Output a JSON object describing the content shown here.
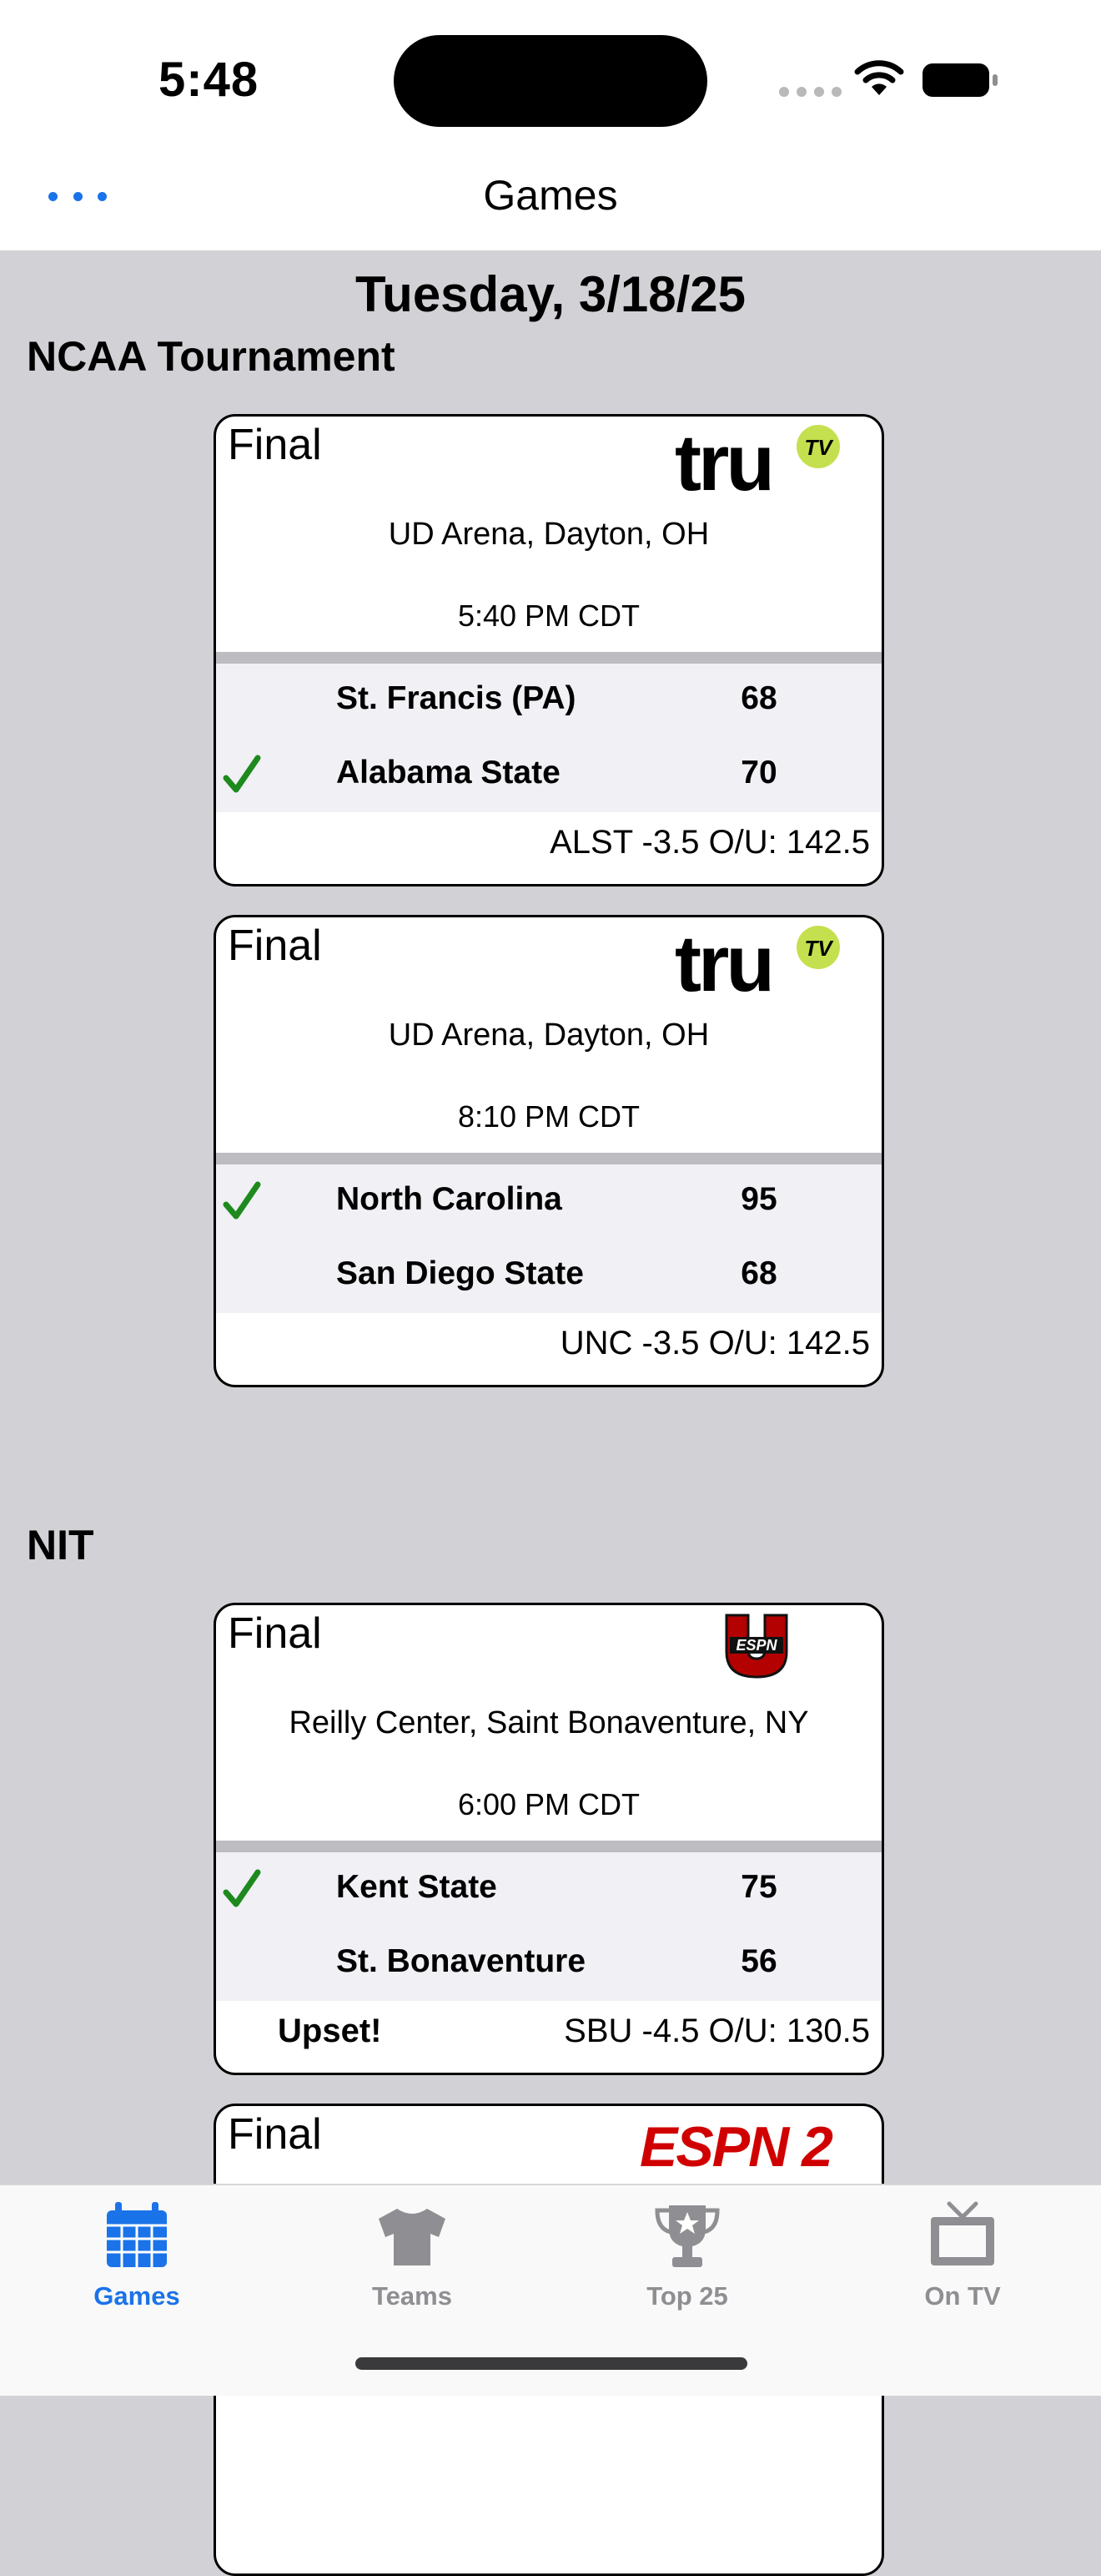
{
  "status_bar": {
    "time": "5:48"
  },
  "nav": {
    "title": "Games",
    "more_icon": "ellipsis-icon"
  },
  "date": "Tuesday, 3/18/25",
  "sections": [
    {
      "name": "NCAA Tournament",
      "games": [
        {
          "status": "Final",
          "network": "truTV",
          "venue": "UD Arena, Dayton, OH",
          "time": "5:40 PM CDT",
          "team1": "St. Francis (PA)",
          "score1": "68",
          "team2": "Alabama State",
          "score2": "70",
          "winner": 2,
          "tag": "",
          "odds": "ALST -3.5 O/U: 142.5"
        },
        {
          "status": "Final",
          "network": "truTV",
          "venue": "UD Arena, Dayton, OH",
          "time": "8:10 PM CDT",
          "team1": "North Carolina",
          "score1": "95",
          "team2": "San Diego State",
          "score2": "68",
          "winner": 1,
          "tag": "",
          "odds": "UNC -3.5 O/U: 142.5"
        }
      ]
    },
    {
      "name": "NIT",
      "games": [
        {
          "status": "Final",
          "network": "ESPNU",
          "venue": "Reilly Center, Saint Bonaventure, NY",
          "time": "6:00 PM CDT",
          "team1": "Kent State",
          "score1": "75",
          "team2": "St. Bonaventure",
          "score2": "56",
          "winner": 1,
          "tag": "Upset!",
          "odds": "SBU -4.5 O/U: 130.5"
        },
        {
          "status": "Final",
          "network": "ESPN2"
        }
      ]
    }
  ],
  "logos": {
    "tru_text": "tru",
    "tv_text": "TV",
    "espnu_text": "ESPN",
    "espn2_text": "ESPN 2"
  },
  "tabs": [
    {
      "label": "Games",
      "icon": "calendar-icon",
      "active": true
    },
    {
      "label": "Teams",
      "icon": "jersey-icon",
      "active": false
    },
    {
      "label": "Top 25",
      "icon": "trophy-icon",
      "active": false
    },
    {
      "label": "On TV",
      "icon": "tv-icon",
      "active": false
    }
  ],
  "colors": {
    "accent": "#1a73e8",
    "check": "#1e8a1e",
    "trutv_badge": "#c5e04e",
    "espn_red": "#d00000"
  }
}
